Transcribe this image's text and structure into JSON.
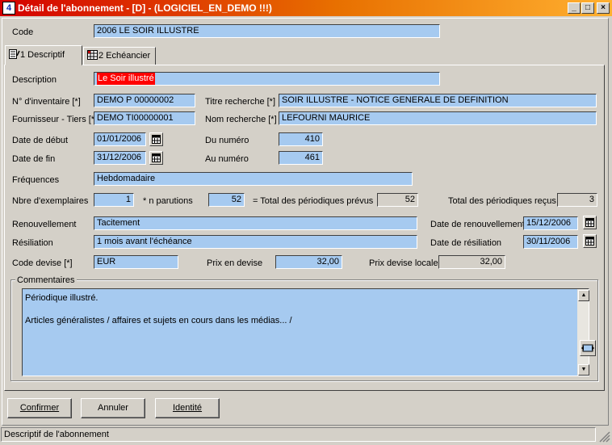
{
  "window": {
    "title": "Détail de l'abonnement - [D] - (LOGICIEL_EN_DEMO !!!)",
    "app_icon_text": "4",
    "minimize": "_",
    "maximize": "□",
    "close": "×"
  },
  "code": {
    "label": "Code",
    "value": "2006 LE SOIR ILLUSTRE"
  },
  "tabs": [
    {
      "label": "1 Descriptif",
      "icon": "descriptif-icon"
    },
    {
      "label": "2 Echéancier",
      "icon": "echeancier-icon"
    }
  ],
  "form": {
    "description": {
      "label": "Description",
      "value": "Le Soir illustré"
    },
    "inventaire": {
      "label": "N° d'inventaire [*]",
      "value": "DEMO P 00000002"
    },
    "titre_recherche": {
      "label": "Titre recherche [*]",
      "value": "SOIR ILLUSTRE - NOTICE GENERALE DE DEFINITION"
    },
    "fournisseur": {
      "label": "Fournisseur - Tiers [*]",
      "value": "DEMO TI00000001"
    },
    "nom_recherche": {
      "label": "Nom recherche [*]",
      "value": "LEFOURNI MAURICE"
    },
    "date_debut": {
      "label": "Date de début",
      "value": "01/01/2006"
    },
    "du_numero": {
      "label": "Du numéro",
      "value": "410"
    },
    "date_fin": {
      "label": "Date de fin",
      "value": "31/12/2006"
    },
    "au_numero": {
      "label": "Au numéro",
      "value": "461"
    },
    "frequences": {
      "label": "Fréquences",
      "value": "Hebdomadaire"
    },
    "nbre_exemplaires": {
      "label": "Nbre d'exemplaires",
      "value": "1"
    },
    "n_parutions": {
      "label": "* n parutions",
      "value": "52"
    },
    "total_prevus": {
      "label": "= Total des périodiques prévus",
      "value": "52"
    },
    "total_recus": {
      "label": "Total des périodiques reçus",
      "value": "3"
    },
    "renouvellement": {
      "label": "Renouvellement",
      "value": "Tacitement"
    },
    "date_renouvellement": {
      "label": "Date de renouvellement",
      "value": "15/12/2006"
    },
    "resiliation": {
      "label": "Résiliation",
      "value": "1 mois avant l'échéance"
    },
    "date_resiliation": {
      "label": "Date de résiliation",
      "value": "30/11/2006"
    },
    "code_devise": {
      "label": "Code devise [*]",
      "value": "EUR"
    },
    "prix_devise": {
      "label": "Prix en devise",
      "value": "32,00"
    },
    "prix_devise_locale": {
      "label": "Prix devise locale",
      "value": "32,00"
    }
  },
  "commentaires": {
    "label": "Commentaires",
    "lines": [
      "Périodique illustré.",
      "",
      "Articles généralistes / affaires et sujets en cours dans les médias... /"
    ]
  },
  "buttons": {
    "confirmer": "Confirmer",
    "annuler": "Annuler",
    "identite": "Identité"
  },
  "status": {
    "text": "Descriptif de l'abonnement"
  },
  "colors": {
    "field_bg": "#a6caf0",
    "face": "#d4d0c8",
    "title_start": "#d40000",
    "title_end": "#ffb030",
    "highlight": "#ff0000"
  }
}
